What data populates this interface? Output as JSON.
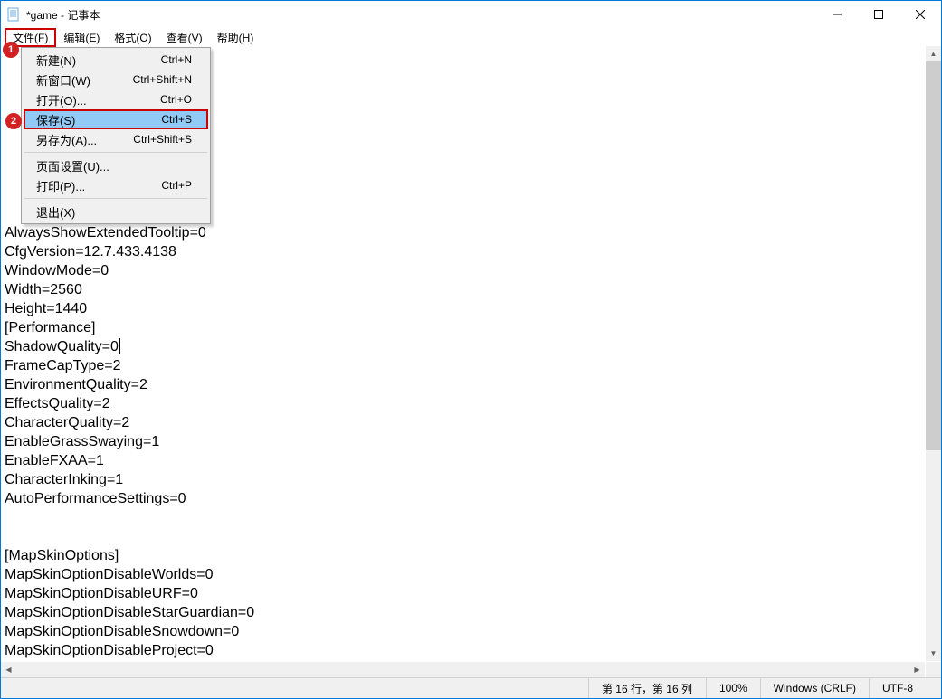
{
  "title": "*game - 记事本",
  "menubar": {
    "file": "文件(F)",
    "edit": "编辑(E)",
    "format": "格式(O)",
    "view": "查看(V)",
    "help": "帮助(H)"
  },
  "file_menu": {
    "new": "新建(N)",
    "new_sc": "Ctrl+N",
    "newwin": "新窗口(W)",
    "newwin_sc": "Ctrl+Shift+N",
    "open": "打开(O)...",
    "open_sc": "Ctrl+O",
    "save": "保存(S)",
    "save_sc": "Ctrl+S",
    "saveas": "另存为(A)...",
    "saveas_sc": "Ctrl+Shift+S",
    "pagesetup": "页面设置(U)...",
    "print": "打印(P)...",
    "print_sc": "Ctrl+P",
    "exit": "退出(X)"
  },
  "badges": {
    "one": "1",
    "two": "2"
  },
  "content_lines": [
    "AlwaysShowExtendedTooltip=0",
    "CfgVersion=12.7.433.4138",
    "WindowMode=0",
    "Width=2560",
    "Height=1440",
    "[Performance]",
    "ShadowQuality=0",
    "FrameCapType=2",
    "EnvironmentQuality=2",
    "EffectsQuality=2",
    "CharacterQuality=2",
    "EnableGrassSwaying=1",
    "EnableFXAA=1",
    "CharacterInking=1",
    "AutoPerformanceSettings=0",
    "",
    "",
    "[MapSkinOptions]",
    "MapSkinOptionDisableWorlds=0",
    "MapSkinOptionDisableURF=0",
    "MapSkinOptionDisableStarGuardian=0",
    "MapSkinOptionDisableSnowdown=0",
    "MapSkinOptionDisableProject=0"
  ],
  "caret_line_index": 6,
  "status": {
    "pos": "第 16 行，第 16 列",
    "zoom": "100%",
    "eol": "Windows (CRLF)",
    "enc": "UTF-8"
  }
}
